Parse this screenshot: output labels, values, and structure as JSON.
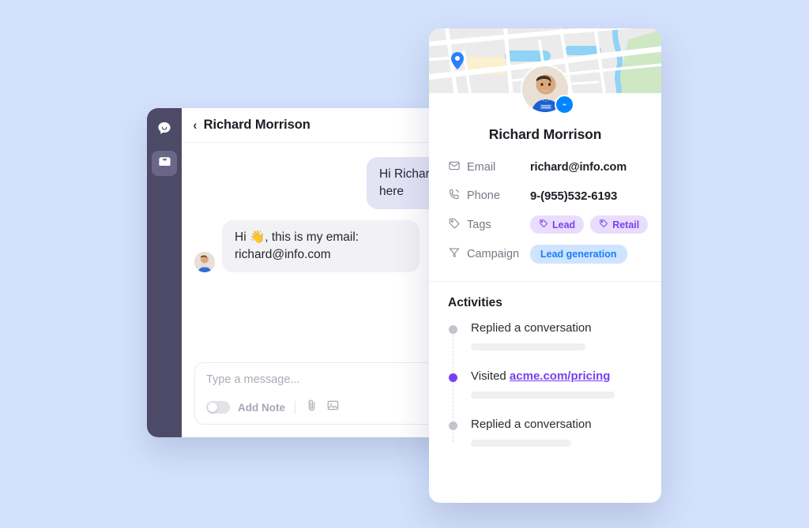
{
  "theme": {
    "page_background": "#d3e1fc",
    "sidebar": "#4d4a68",
    "accent_purple": "#7b3ff2",
    "accent_blue": "#1a7cff",
    "bubble_out": "#e3e3f6",
    "bubble_in": "#f2f2f4"
  },
  "chat": {
    "rail": {
      "chat_icon": "chat-bubble-icon",
      "inbox_icon": "inbox-tray-icon"
    },
    "header": {
      "back_chevron": "‹",
      "title": "Richard Morrison"
    },
    "messages": [
      {
        "direction": "out",
        "text": "Hi Richard, leave your email here"
      },
      {
        "direction": "in",
        "text": "Hi 👋, this is my email: richard@info.com"
      }
    ],
    "composer": {
      "placeholder": "Type a message...",
      "note_toggle_label": "Add Note",
      "note_toggle_state": "off",
      "attach_icon": "paperclip-icon",
      "image_icon": "image-icon"
    }
  },
  "contact_card": {
    "map": {
      "pin_icon": "map-pin-icon"
    },
    "avatar": {
      "badge_icon": "messenger-icon"
    },
    "name": "Richard Morrison",
    "details": [
      {
        "icon": "envelope-icon",
        "label": "Email",
        "value": "richard@info.com",
        "type": "text"
      },
      {
        "icon": "phone-icon",
        "label": "Phone",
        "value": "9-(955)532-6193",
        "type": "phone"
      },
      {
        "icon": "tag-icon",
        "label": "Tags",
        "type": "tags",
        "tags": [
          "Lead",
          "Retail"
        ]
      },
      {
        "icon": "funnel-icon",
        "label": "Campaign",
        "type": "campaign",
        "campaign": "Lead generation"
      }
    ],
    "activities": {
      "title": "Activities",
      "items": [
        {
          "prefix": "Replied a conversation",
          "link": "",
          "current": false
        },
        {
          "prefix": "Visited ",
          "link": "acme.com/pricing",
          "current": true
        },
        {
          "prefix": "Replied a conversation",
          "link": "",
          "current": false
        }
      ]
    }
  }
}
